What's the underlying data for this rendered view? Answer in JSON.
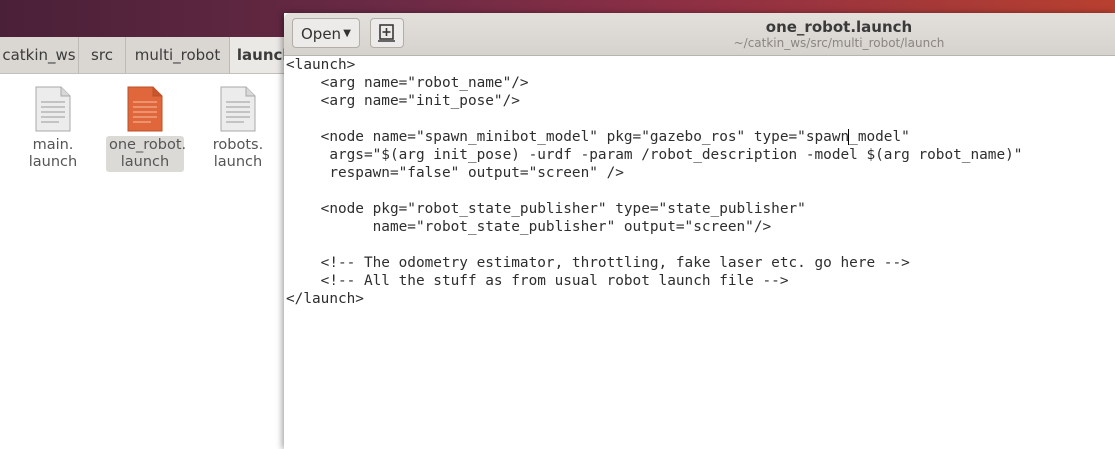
{
  "file_manager": {
    "breadcrumbs": [
      "catkin_ws",
      "src",
      "multi_robot",
      "launch"
    ],
    "files": [
      {
        "line1": "main.",
        "line2": "launch",
        "icon": "text-file-icon",
        "selected": false
      },
      {
        "line1": "one_robot.",
        "line2": "launch",
        "icon": "text-file-icon",
        "selected": true
      },
      {
        "line1": "robots.",
        "line2": "launch",
        "icon": "text-file-icon",
        "selected": false
      }
    ]
  },
  "editor_window": {
    "open_label": "Open",
    "new_document_icon": "new-document-icon",
    "title": "one_robot.launch",
    "subtitle": "~/catkin_ws/src/multi_robot/launch",
    "cursor": {
      "line": 6,
      "column": 65
    },
    "lines": [
      "<launch>",
      "    <arg name=\"robot_name\"/>",
      "    <arg name=\"init_pose\"/>",
      "",
      "    <node name=\"spawn_minibot_model\" pkg=\"gazebo_ros\" type=\"spawn_model\"",
      "     args=\"$(arg init_pose) -urdf -param /robot_description -model $(arg robot_name)\"",
      "     respawn=\"false\" output=\"screen\" />",
      "",
      "    <node pkg=\"robot_state_publisher\" type=\"state_publisher\"",
      "          name=\"robot_state_publisher\" output=\"screen\"/>",
      "",
      "    <!-- The odometry estimator, throttling, fake laser etc. go here -->",
      "    <!-- All the stuff as from usual robot launch file -->",
      "</launch>"
    ]
  },
  "colors": {
    "selected_file_icon": "#e0673b",
    "plain_file_icon": "#e8e8e8"
  }
}
